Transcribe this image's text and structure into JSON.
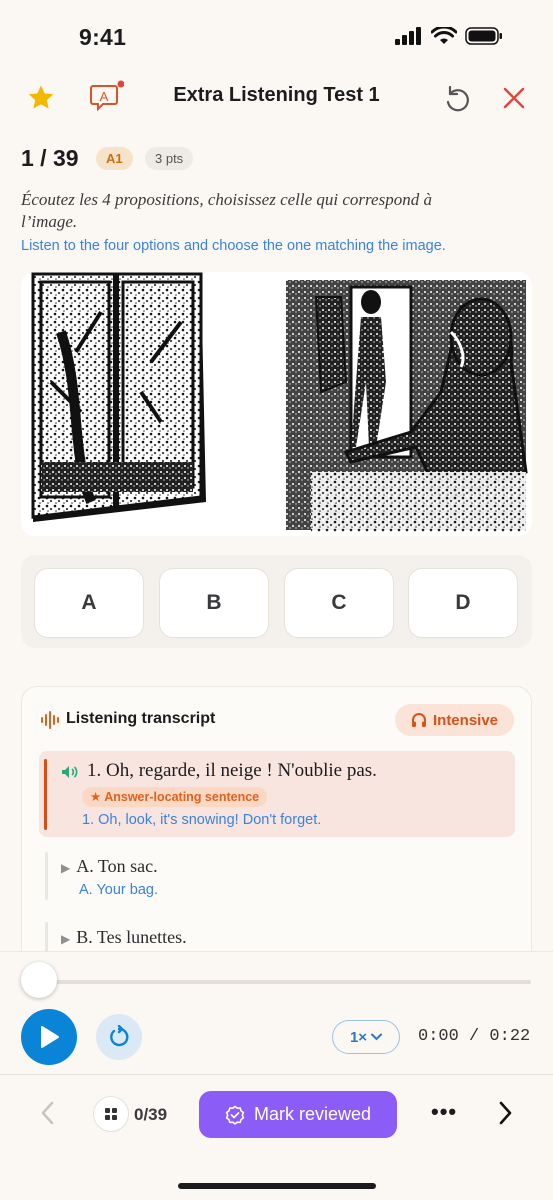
{
  "status": {
    "time": "9:41"
  },
  "header": {
    "title": "Extra Listening Test 1"
  },
  "question": {
    "counter": "1 / 39",
    "level": "A1",
    "points": "3 pts",
    "instruction_fr": "Écoutez les 4 propositions, choisissez celle qui correspond à l’image.",
    "instruction_en": "Listen to the four options and choose the one matching the image."
  },
  "answers": [
    "A",
    "B",
    "C",
    "D"
  ],
  "transcript": {
    "title": "Listening transcript",
    "mode_label": "Intensive",
    "sentence_fr": "1. Oh, regarde, il neige ! N'oublie pas.",
    "locating_label": "★ Answer-locating sentence",
    "sentence_en": "1. Oh, look, it's snowing! Don't forget.",
    "options": [
      {
        "fr": "A. Ton sac.",
        "en": "A. Your bag."
      },
      {
        "fr": "B. Tes lunettes.",
        "en": ""
      }
    ]
  },
  "player": {
    "speed": "1×",
    "time": "0:00 / 0:22",
    "progress": 0
  },
  "footer": {
    "progress": "0/39",
    "mark_label": "Mark reviewed",
    "more": "•••"
  },
  "colors": {
    "accent_blue": "#0a84d6",
    "accent_purple": "#8b5cf6",
    "accent_orange": "#d4541a",
    "star": "#f5b800",
    "close": "#e0463a"
  }
}
